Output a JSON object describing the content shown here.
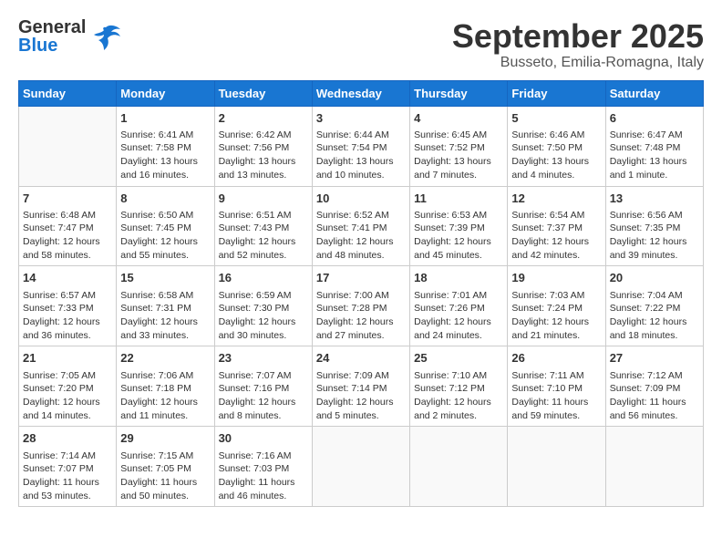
{
  "header": {
    "logo": {
      "general": "General",
      "blue": "Blue"
    },
    "month": "September 2025",
    "location": "Busseto, Emilia-Romagna, Italy"
  },
  "weekdays": [
    "Sunday",
    "Monday",
    "Tuesday",
    "Wednesday",
    "Thursday",
    "Friday",
    "Saturday"
  ],
  "weeks": [
    [
      {
        "day": "",
        "content": ""
      },
      {
        "day": "1",
        "content": "Sunrise: 6:41 AM\nSunset: 7:58 PM\nDaylight: 13 hours\nand 16 minutes."
      },
      {
        "day": "2",
        "content": "Sunrise: 6:42 AM\nSunset: 7:56 PM\nDaylight: 13 hours\nand 13 minutes."
      },
      {
        "day": "3",
        "content": "Sunrise: 6:44 AM\nSunset: 7:54 PM\nDaylight: 13 hours\nand 10 minutes."
      },
      {
        "day": "4",
        "content": "Sunrise: 6:45 AM\nSunset: 7:52 PM\nDaylight: 13 hours\nand 7 minutes."
      },
      {
        "day": "5",
        "content": "Sunrise: 6:46 AM\nSunset: 7:50 PM\nDaylight: 13 hours\nand 4 minutes."
      },
      {
        "day": "6",
        "content": "Sunrise: 6:47 AM\nSunset: 7:48 PM\nDaylight: 13 hours\nand 1 minute."
      }
    ],
    [
      {
        "day": "7",
        "content": "Sunrise: 6:48 AM\nSunset: 7:47 PM\nDaylight: 12 hours\nand 58 minutes."
      },
      {
        "day": "8",
        "content": "Sunrise: 6:50 AM\nSunset: 7:45 PM\nDaylight: 12 hours\nand 55 minutes."
      },
      {
        "day": "9",
        "content": "Sunrise: 6:51 AM\nSunset: 7:43 PM\nDaylight: 12 hours\nand 52 minutes."
      },
      {
        "day": "10",
        "content": "Sunrise: 6:52 AM\nSunset: 7:41 PM\nDaylight: 12 hours\nand 48 minutes."
      },
      {
        "day": "11",
        "content": "Sunrise: 6:53 AM\nSunset: 7:39 PM\nDaylight: 12 hours\nand 45 minutes."
      },
      {
        "day": "12",
        "content": "Sunrise: 6:54 AM\nSunset: 7:37 PM\nDaylight: 12 hours\nand 42 minutes."
      },
      {
        "day": "13",
        "content": "Sunrise: 6:56 AM\nSunset: 7:35 PM\nDaylight: 12 hours\nand 39 minutes."
      }
    ],
    [
      {
        "day": "14",
        "content": "Sunrise: 6:57 AM\nSunset: 7:33 PM\nDaylight: 12 hours\nand 36 minutes."
      },
      {
        "day": "15",
        "content": "Sunrise: 6:58 AM\nSunset: 7:31 PM\nDaylight: 12 hours\nand 33 minutes."
      },
      {
        "day": "16",
        "content": "Sunrise: 6:59 AM\nSunset: 7:30 PM\nDaylight: 12 hours\nand 30 minutes."
      },
      {
        "day": "17",
        "content": "Sunrise: 7:00 AM\nSunset: 7:28 PM\nDaylight: 12 hours\nand 27 minutes."
      },
      {
        "day": "18",
        "content": "Sunrise: 7:01 AM\nSunset: 7:26 PM\nDaylight: 12 hours\nand 24 minutes."
      },
      {
        "day": "19",
        "content": "Sunrise: 7:03 AM\nSunset: 7:24 PM\nDaylight: 12 hours\nand 21 minutes."
      },
      {
        "day": "20",
        "content": "Sunrise: 7:04 AM\nSunset: 7:22 PM\nDaylight: 12 hours\nand 18 minutes."
      }
    ],
    [
      {
        "day": "21",
        "content": "Sunrise: 7:05 AM\nSunset: 7:20 PM\nDaylight: 12 hours\nand 14 minutes."
      },
      {
        "day": "22",
        "content": "Sunrise: 7:06 AM\nSunset: 7:18 PM\nDaylight: 12 hours\nand 11 minutes."
      },
      {
        "day": "23",
        "content": "Sunrise: 7:07 AM\nSunset: 7:16 PM\nDaylight: 12 hours\nand 8 minutes."
      },
      {
        "day": "24",
        "content": "Sunrise: 7:09 AM\nSunset: 7:14 PM\nDaylight: 12 hours\nand 5 minutes."
      },
      {
        "day": "25",
        "content": "Sunrise: 7:10 AM\nSunset: 7:12 PM\nDaylight: 12 hours\nand 2 minutes."
      },
      {
        "day": "26",
        "content": "Sunrise: 7:11 AM\nSunset: 7:10 PM\nDaylight: 11 hours\nand 59 minutes."
      },
      {
        "day": "27",
        "content": "Sunrise: 7:12 AM\nSunset: 7:09 PM\nDaylight: 11 hours\nand 56 minutes."
      }
    ],
    [
      {
        "day": "28",
        "content": "Sunrise: 7:14 AM\nSunset: 7:07 PM\nDaylight: 11 hours\nand 53 minutes."
      },
      {
        "day": "29",
        "content": "Sunrise: 7:15 AM\nSunset: 7:05 PM\nDaylight: 11 hours\nand 50 minutes."
      },
      {
        "day": "30",
        "content": "Sunrise: 7:16 AM\nSunset: 7:03 PM\nDaylight: 11 hours\nand 46 minutes."
      },
      {
        "day": "",
        "content": ""
      },
      {
        "day": "",
        "content": ""
      },
      {
        "day": "",
        "content": ""
      },
      {
        "day": "",
        "content": ""
      }
    ]
  ]
}
